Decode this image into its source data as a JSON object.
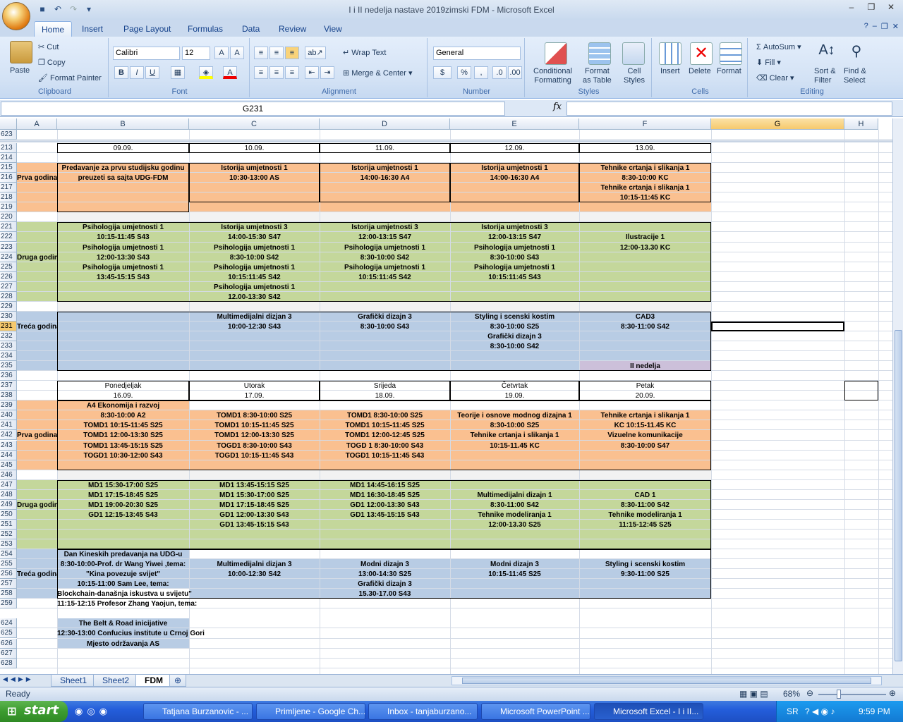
{
  "window": {
    "title": "I i II nedelja nastave 2019zimski FDM - Microsoft Excel",
    "controls": [
      "–",
      "❐",
      "✕"
    ]
  },
  "ribbon_tabs": [
    "Home",
    "Insert",
    "Page Layout",
    "Formulas",
    "Data",
    "Review",
    "View"
  ],
  "clipboard": {
    "paste": "Paste",
    "cut": "Cut",
    "copy": "Copy",
    "format_painter": "Format Painter",
    "label": "Clipboard"
  },
  "font": {
    "name": "Calibri",
    "size": "12",
    "label": "Font",
    "bold": "B",
    "italic": "I",
    "underline": "U"
  },
  "alignment": {
    "wrap": "Wrap Text",
    "merge": "Merge & Center",
    "label": "Alignment"
  },
  "number": {
    "format": "General",
    "label": "Number",
    "currency": "$",
    "percent": "%",
    "comma": ","
  },
  "styles": {
    "conditional": "Conditional",
    "conditional2": "Formatting",
    "format_table": "Format",
    "format_table2": "as Table",
    "cell_styles": "Cell",
    "cell_styles2": "Styles",
    "label": "Styles"
  },
  "cells": {
    "insert": "Insert",
    "delete": "Delete",
    "format": "Format",
    "label": "Cells"
  },
  "editing": {
    "autosum": "AutoSum",
    "fill": "Fill",
    "clear": "Clear",
    "sort": "Sort &",
    "sort2": "Filter",
    "find": "Find &",
    "find2": "Select",
    "label": "Editing"
  },
  "formula_bar": {
    "name_box": "G231",
    "fx": "fx",
    "content": ""
  },
  "columns": [
    "A",
    "B",
    "C",
    "D",
    "E",
    "F",
    "G",
    "H"
  ],
  "selected_column": "G",
  "selected_row": "231",
  "frozen_row": "623",
  "rows": [
    "213",
    "214",
    "215",
    "216",
    "217",
    "218",
    "219",
    "220",
    "221",
    "222",
    "223",
    "224",
    "225",
    "226",
    "227",
    "228",
    "229",
    "230",
    "231",
    "232",
    "233",
    "234",
    "235",
    "236",
    "237",
    "238",
    "239",
    "240",
    "241",
    "242",
    "243",
    "244",
    "245",
    "246",
    "247",
    "248",
    "249",
    "250",
    "251",
    "252",
    "253",
    "254",
    "255",
    "256",
    "257",
    "258",
    "259",
    "623",
    "624",
    "625",
    "626",
    "627",
    "628"
  ],
  "week1": {
    "dates": [
      "09.09.",
      "10.09.",
      "11.09.",
      "12.09.",
      "13.09."
    ],
    "prva": "Prva godina",
    "druga": "Druga godina",
    "treca": "Treća godina",
    "b215": "Predavanje za prvu studijsku godinu",
    "b216": "preuzeti sa sajta UDG-FDM",
    "c215": "Istorija umjetnosti 1",
    "c216": "10:30-13:00 AS",
    "d215": "Istorija umjetnosti 1",
    "d216": "14:00-16:30  A4",
    "e215": "Istorija umjetnosti 1",
    "e216": "14:00-16:30  A4",
    "f215": "Tehnike crtanja i slikanja 1",
    "f216": "8:30-10:00 KC",
    "f217": "Tehnike crtanja i slikanja 1",
    "f218": "10:15-11:45 KC",
    "b221": "Psihologija umjetnosti 1",
    "b222": "10:15-11:45 S43",
    "b223": "Psihologija umjetnosti 1",
    "b224": "12:00-13:30 S43",
    "b225": "Psihologija umjetnosti 1",
    "b226": "13:45-15:15 S43",
    "c221": "Istorija umjetnosti 3",
    "c222": "14:00-15:30 S47",
    "c223": "Psihologija umjetnosti 1",
    "c224": "8:30-10:00 S42",
    "c225": "Psihologija umjetnosti 1",
    "c226": "10:15:11:45 S42",
    "c227": "Psihologija umjetnosti 1",
    "c228": "12.00-13:30 S42",
    "d221": "Istorija umjetnosti 3",
    "d222": "12:00-13:15 S47",
    "d223": "Psihologija umjetnosti 1",
    "d224": "8:30-10:00 S42",
    "d225": "Psihologija umjetnosti 1",
    "d226": "10:15:11:45 S42",
    "e221": "Istorija umjetnosti 3",
    "e222": "12:00-13:15 S47",
    "e223": "Psihologija umjetnosti 1",
    "e224": "8:30-10:00 S43",
    "e225": "Psihologija umjetnosti 1",
    "e226": "10:15:11:45 S43",
    "f222": "Ilustracije 1",
    "f223": "12:00-13.30 KC",
    "c230": "Multimedijalni dizjan 3",
    "c231": "10:00-12:30 S43",
    "d230": "Grafički dizajn 3",
    "d231": "8:30-10:00 S43",
    "e230": "Styling i scenski kostim",
    "e231": "8:30-10:00 S25",
    "e232": "Grafički dizajn 3",
    "e233": "8:30-10:00 S42",
    "f230": "CAD3",
    "f231": "8:30-11:00 S42",
    "f235": "II nedelja"
  },
  "week2": {
    "days": [
      "Ponedjeljak",
      "Utorak",
      "Srijeda",
      "Četvrtak",
      "Petak"
    ],
    "dates": [
      "16.09.",
      "17.09.",
      "18.09.",
      "19.09.",
      "20.09."
    ],
    "prva": "Prva godina",
    "druga": "Druga godina",
    "treca": "Treća godina",
    "b239": "A4 Ekonomija i razvoj",
    "b240": "8:30-10:00 A2",
    "b241": "TOMD1 10:15-11:45 S25",
    "b242": "TOMD1 12:00-13:30 S25",
    "b243": "TOMD1 13:45-15:15 S25",
    "b244": "TOGD1 10:30-12:00 S43",
    "c240": "TOMD1 8:30-10:00 S25",
    "c241": "TOMD1 10:15-11:45 S25",
    "c242": "TOMD1 12:00-13:30 S25",
    "c243": "TOGD1 8:30-10:00 S43",
    "c244": "TOGD1 10:15-11:45 S43",
    "d240": "TOMD1 8:30-10:00 S25",
    "d241": "TOMD1 10:15-11:45 S25",
    "d242": "TOMD1 12:00-12:45 S25",
    "d243": "TOGD 1 8:30-10:00 S43",
    "d244": "TOGD1 10:15-11:45 S43",
    "e240": "Teorije i osnove modnog dizajna 1",
    "e241": "8:30-10:00 S25",
    "e242": "Tehnike crtanja i slikanja 1",
    "e243": "10:15-11.45 KC",
    "f240": "Tehnike crtanja i slikanja 1",
    "f241": "KC 10:15-11.45  KC",
    "f242": "Vizuelne komunikacije",
    "f243": "8:30-10:00 S47",
    "b247": "MD1 15:30-17:00 S25",
    "b248": "MD1 17:15-18:45 S25",
    "b249": "MD1 19:00-20:30 S25",
    "b250": "GD1 12:15-13:45 S43",
    "c247": "MD1 13:45-15:15 S25",
    "c248": "MD1 15:30-17:00 S25",
    "c249": "MD1 17:15-18:45 S25",
    "c250": "GD1 12:00-13:30 S43",
    "c251": "GD1 13:45-15:15 S43",
    "d247": "MD1 14:45-16:15 S25",
    "d248": "MD1 16:30-18:45 S25",
    "d249": "GD1 12:00-13:30 S43",
    "d250": "GD1 13:45-15:15 S43",
    "e248": "Multimedijalni dizajn 1",
    "e249": "8:30-11:00 S42",
    "e250": "Tehnike modeliranja 1",
    "e251": "12:00-13.30 S25",
    "f248": "CAD 1",
    "f249": "8:30-11:00 S42",
    "f250": "Tehnike modeliranja 1",
    "f251": "11:15-12:45 S25",
    "b254": "Dan Kineskih predavanja na UDG-u",
    "b255": "8:30-10:00-Prof. dr Wang Yiwei ,tema:",
    "b256": "\"Kina povezuje svijet\"",
    "b257": "10:15-11:00 Sam Lee, tema:",
    "b258": "Blockchain-današnja iskustva u svijetu\"",
    "b259": "11:15-12:15 Profesor Zhang Yaojun, tema:",
    "c255": "Multimedijalni dizjan 3",
    "c256": "10:00-12:30 S42",
    "d255": "Modni dizajn 3",
    "d256": "13:00-14:30 S25",
    "d257": "Grafički dizajn 3",
    "d258": "15.30-17.00 S43",
    "e255": "Modni dizajn 3",
    "e256": "10:15-11:45 S25",
    "f255": "Styling i scenski kostim",
    "f256": "9:30-11:00 S25",
    "b624": "The Belt & Road inicijative",
    "b625": "12:30-13:00 Confucius institute u Crnoj Gori",
    "b626": "Mjesto održavanja AS"
  },
  "sheet_tabs": [
    "Sheet1",
    "Sheet2",
    "FDM"
  ],
  "active_sheet": "FDM",
  "status": {
    "text": "Ready",
    "zoom": "68%"
  },
  "taskbar": {
    "start": "start",
    "tasks": [
      "Tatjana Burzanovic - ...",
      "Primljene - Google Ch...",
      "Inbox - tanjaburzano...",
      "Microsoft PowerPoint ...",
      "Microsoft Excel - I i II..."
    ],
    "lang": "SR",
    "time": "9:59 PM"
  }
}
